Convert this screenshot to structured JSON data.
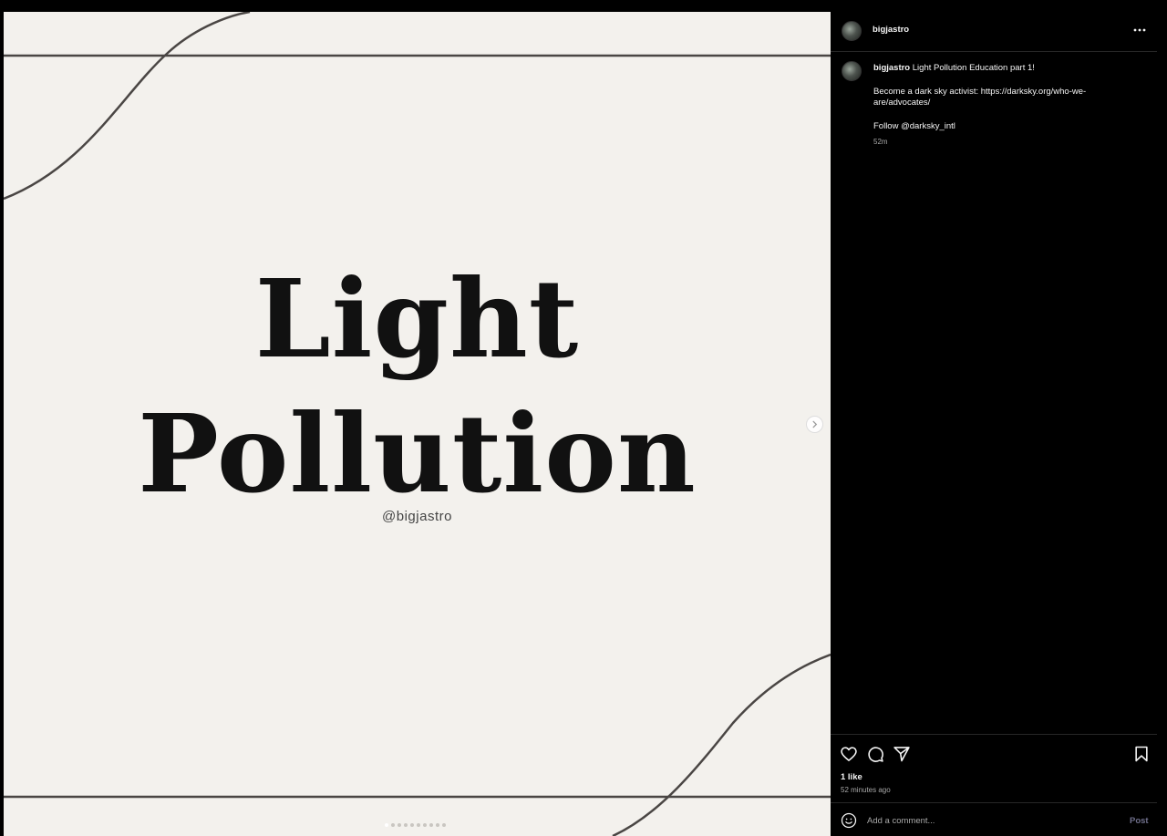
{
  "slide": {
    "title_line_1": "Light",
    "title_line_2": "Pollution",
    "handle": "@bigjastro",
    "dots_total": 10,
    "active_dot": 1
  },
  "post": {
    "username": "bigjastro",
    "caption_text": "Light Pollution Education part 1!",
    "caption_line_2": "Become a dark sky activist: https://darksky.org/who-we-are/advocates/",
    "caption_line_3": "Follow @darksky_intl",
    "caption_age": "52m",
    "likes": "1 like",
    "time_ago": "52 minutes ago"
  },
  "comment": {
    "placeholder": "Add a comment...",
    "post_label": "Post"
  },
  "icons": {
    "more": "more-horizontal-icon",
    "like": "heart-icon",
    "comment": "comment-bubble-icon",
    "share": "paper-plane-icon",
    "save": "bookmark-icon",
    "emoji": "emoji-smile-icon",
    "next": "chevron-right-icon"
  },
  "colors": {
    "background": "#000000",
    "slide_bg": "#f3f1ed",
    "text": "#f5f5f5",
    "muted": "#a8a8a8",
    "post_button": "#6e6e8a"
  }
}
